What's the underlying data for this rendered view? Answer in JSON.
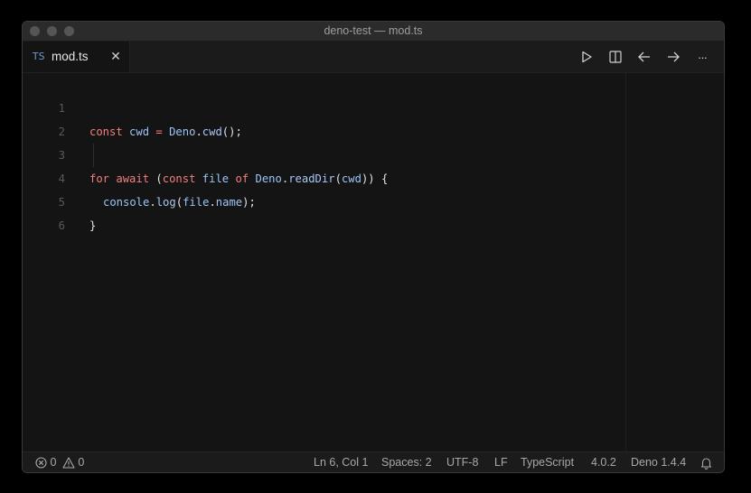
{
  "window": {
    "title": "deno-test — mod.ts"
  },
  "tab": {
    "icon_text": "TS",
    "label": "mod.ts",
    "close": "✕"
  },
  "toolbar": {
    "run_icon": "play-icon",
    "split_icon": "split-editor-icon",
    "back_icon": "arrow-left-icon",
    "forward_icon": "arrow-right-icon",
    "more_label": "···"
  },
  "editor": {
    "lines": [
      {
        "num": "1"
      },
      {
        "num": "2"
      },
      {
        "num": "3"
      },
      {
        "num": "4"
      },
      {
        "num": "5"
      },
      {
        "num": "6"
      }
    ],
    "tokens": {
      "l1_const": "const",
      "l1_cwd": "cwd",
      "l1_eq": "=",
      "l1_deno": "Deno",
      "l1_dot": ".",
      "l1_fn": "cwd",
      "l1_end": "();",
      "l3_for": "for",
      "l3_await": "await",
      "l3_paren": "(",
      "l3_const": "const",
      "l3_file": "file",
      "l3_of": "of",
      "l3_deno": "Deno",
      "l3_dot": ".",
      "l3_fn": "readDir",
      "l3_p2": "(",
      "l3_cwd": "cwd",
      "l3_end": ")) {",
      "l4_console": "console",
      "l4_dot": ".",
      "l4_log": "log",
      "l4_p": "(",
      "l4_file": "file",
      "l4_dot2": ".",
      "l4_name": "name",
      "l4_end": ");",
      "l5_brace": "}"
    }
  },
  "status": {
    "errors": "0",
    "warnings": "0",
    "position": "Ln 6, Col 1",
    "spaces": "Spaces: 2",
    "encoding": "UTF-8",
    "eol": "LF",
    "language": "TypeScript",
    "ts_version": "4.0.2",
    "deno_version": "Deno 1.4.4"
  },
  "colors": {
    "keyword": "#f07f7f",
    "variable": "#9cc4f5",
    "background": "#141414"
  }
}
